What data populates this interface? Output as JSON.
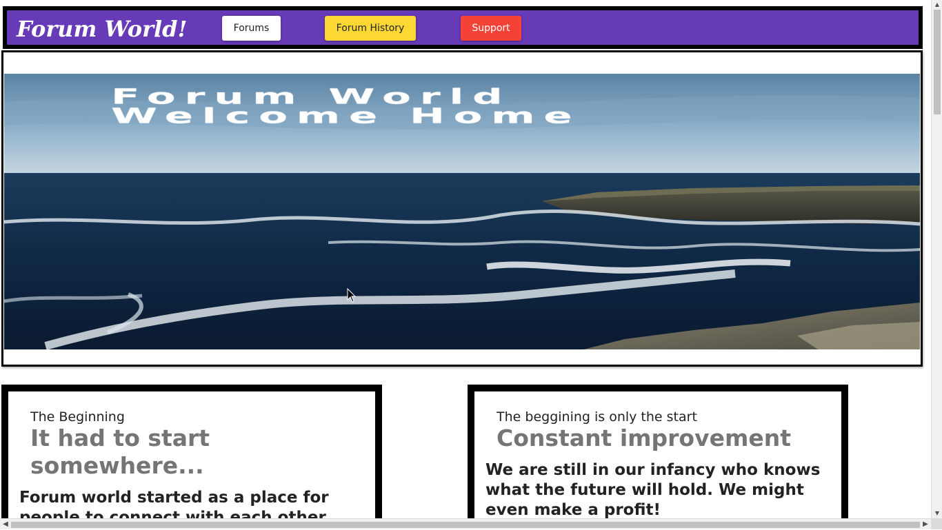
{
  "navbar": {
    "brand": "Forum World!",
    "buttons": [
      {
        "label": "Forums",
        "color": "#ffffff"
      },
      {
        "label": "Forum History",
        "color": "#fdd835"
      },
      {
        "label": "Support",
        "color": "#f44336"
      }
    ],
    "bar_color": "#673ab7"
  },
  "hero": {
    "title_line1": "Forum World",
    "title_line2": "Welcome Home"
  },
  "cards": [
    {
      "subtitle": "The Beginning",
      "heading": "It had to start somewhere...",
      "body": "Forum world started as a place for people to connect with each other"
    },
    {
      "subtitle": "The beggining is only the start",
      "heading": "Constant improvement",
      "body": "We are still in our infancy who knows what the future will hold. We might even make a profit!"
    }
  ],
  "scrollbars": {
    "up": "▲",
    "down": "▼",
    "left": "◀",
    "right": "▶"
  }
}
